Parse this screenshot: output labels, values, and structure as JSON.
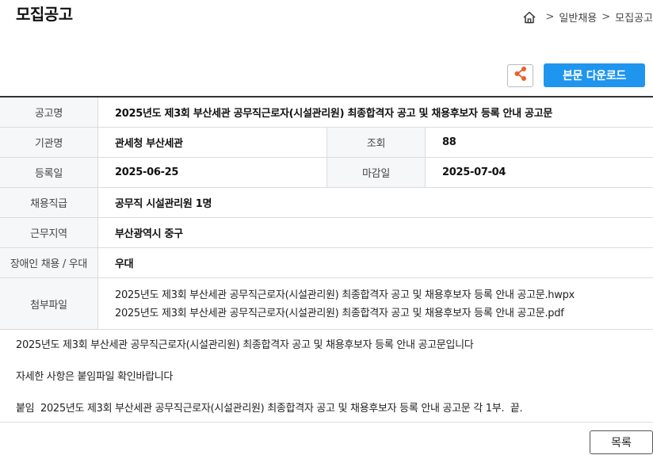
{
  "header": {
    "title": "모집공고",
    "breadcrumb": {
      "home_icon": "home-icon",
      "separator": ">",
      "items": [
        "일반채용",
        "모집공고"
      ]
    }
  },
  "toolbar": {
    "share_icon": "share-icon",
    "download_label": "본문 다운로드",
    "accent_color": "#1f95ee"
  },
  "info": {
    "title_label": "공고명",
    "title_value": "2025년도 제3회 부산세관 공무직근로자(시설관리원) 최종합격자 공고 및 채용후보자 등록 안내 공고문",
    "org_label": "기관명",
    "org_value": "관세청 부산세관",
    "views_label": "조회",
    "views_value": "88",
    "reg_label": "등록일",
    "reg_value": "2025-06-25",
    "deadline_label": "마감일",
    "deadline_value": "2025-07-04",
    "rank_label": "채용직급",
    "rank_value": "공무직 시설관리원 1명",
    "region_label": "근무지역",
    "region_value": "부산광역시 중구",
    "disabled_label": "장애인 채용 / 우대",
    "disabled_value": "우대",
    "attach_label": "첨부파일",
    "attachments": [
      "2025년도 제3회 부산세관 공무직근로자(시설관리원) 최종합격자 공고 및 채용후보자 등록 안내 공고문.hwpx",
      "2025년도 제3회 부산세관 공무직근로자(시설관리원) 최종합격자 공고 및 채용후보자 등록 안내 공고문.pdf"
    ]
  },
  "body": {
    "paragraphs": [
      "2025년도 제3회 부산세관 공무직근로자(시설관리원) 최종합격자 공고 및 채용후보자 등록 안내 공고문입니다",
      "자세한 사항은 붙임파일 확인바랍니다",
      "붙임  2025년도 제3회 부산세관 공무직근로자(시설관리원) 최종합격자 공고 및 채용후보자 등록 안내 공고문 각 1부.  끝."
    ]
  },
  "footer": {
    "list_label": "목록"
  }
}
